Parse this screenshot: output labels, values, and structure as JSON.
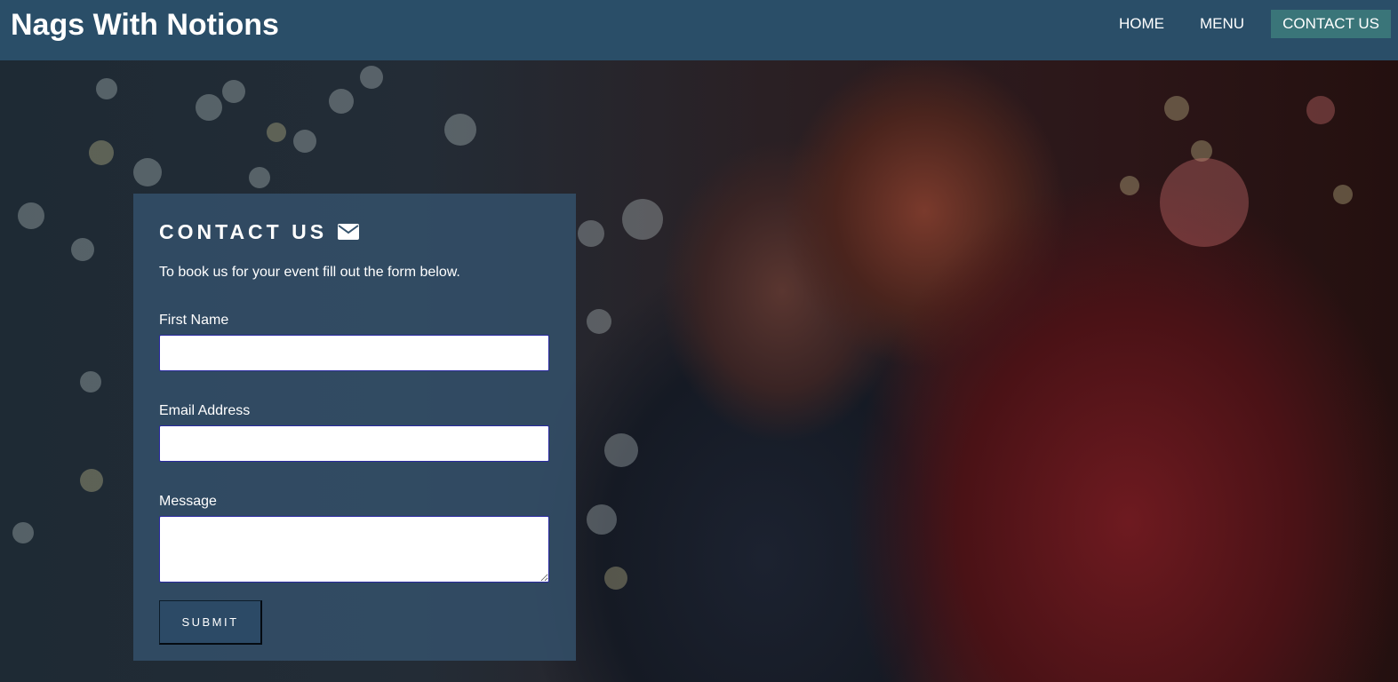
{
  "header": {
    "brand": "Nags With Notions",
    "nav": [
      {
        "label": "HOME",
        "active": false
      },
      {
        "label": "MENU",
        "active": false
      },
      {
        "label": "CONTACT US",
        "active": true
      }
    ]
  },
  "contact": {
    "title": "CONTACT US",
    "title_icon": "envelope-icon",
    "intro": "To book us for your event fill out the form below.",
    "fields": {
      "first_name": {
        "label": "First Name",
        "value": ""
      },
      "email": {
        "label": "Email Address",
        "value": ""
      },
      "message": {
        "label": "Message",
        "value": ""
      }
    },
    "submit_label": "SUBMIT"
  },
  "colors": {
    "header_bg": "#2a4e68",
    "nav_active_bg": "#3a7579",
    "panel_bg": "rgba(52,82,108,0.82)",
    "button_bg": "#2c4a66"
  }
}
